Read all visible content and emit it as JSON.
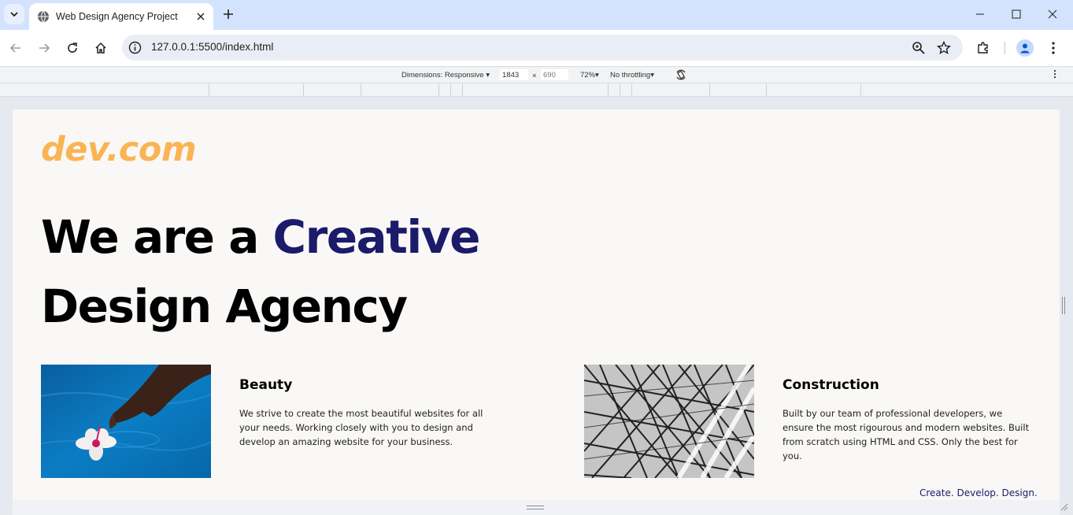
{
  "browser": {
    "tab_title": "Web Design Agency Project",
    "url": "127.0.0.1:5500/index.html"
  },
  "device_toolbar": {
    "dimensions_label": "Dimensions: Responsive",
    "width": "1843",
    "times": "×",
    "height": "690",
    "zoom": "72%",
    "throttling": "No throttling"
  },
  "page": {
    "logo": "dev.com",
    "hero_line1_prefix": "We are a ",
    "hero_line1_accent": "Creative",
    "hero_line2": "Design Agency",
    "cards": [
      {
        "title": "Beauty",
        "text": "We strive to create the most beautiful websites for all your needs. Working closely with you to design and develop an amazing website for your business."
      },
      {
        "title": "Construction",
        "text": "Built by our team of professional developers, we ensure the most rigourous and modern websites. Built from scratch using HTML and CSS. Only the best for you."
      }
    ],
    "tagline": "Create. Develop. Design."
  },
  "colors": {
    "logo": "#fbb454",
    "accent": "#1b1b6a",
    "page_bg": "#f9f8f6",
    "tabstrip": "#d3e3fd"
  }
}
